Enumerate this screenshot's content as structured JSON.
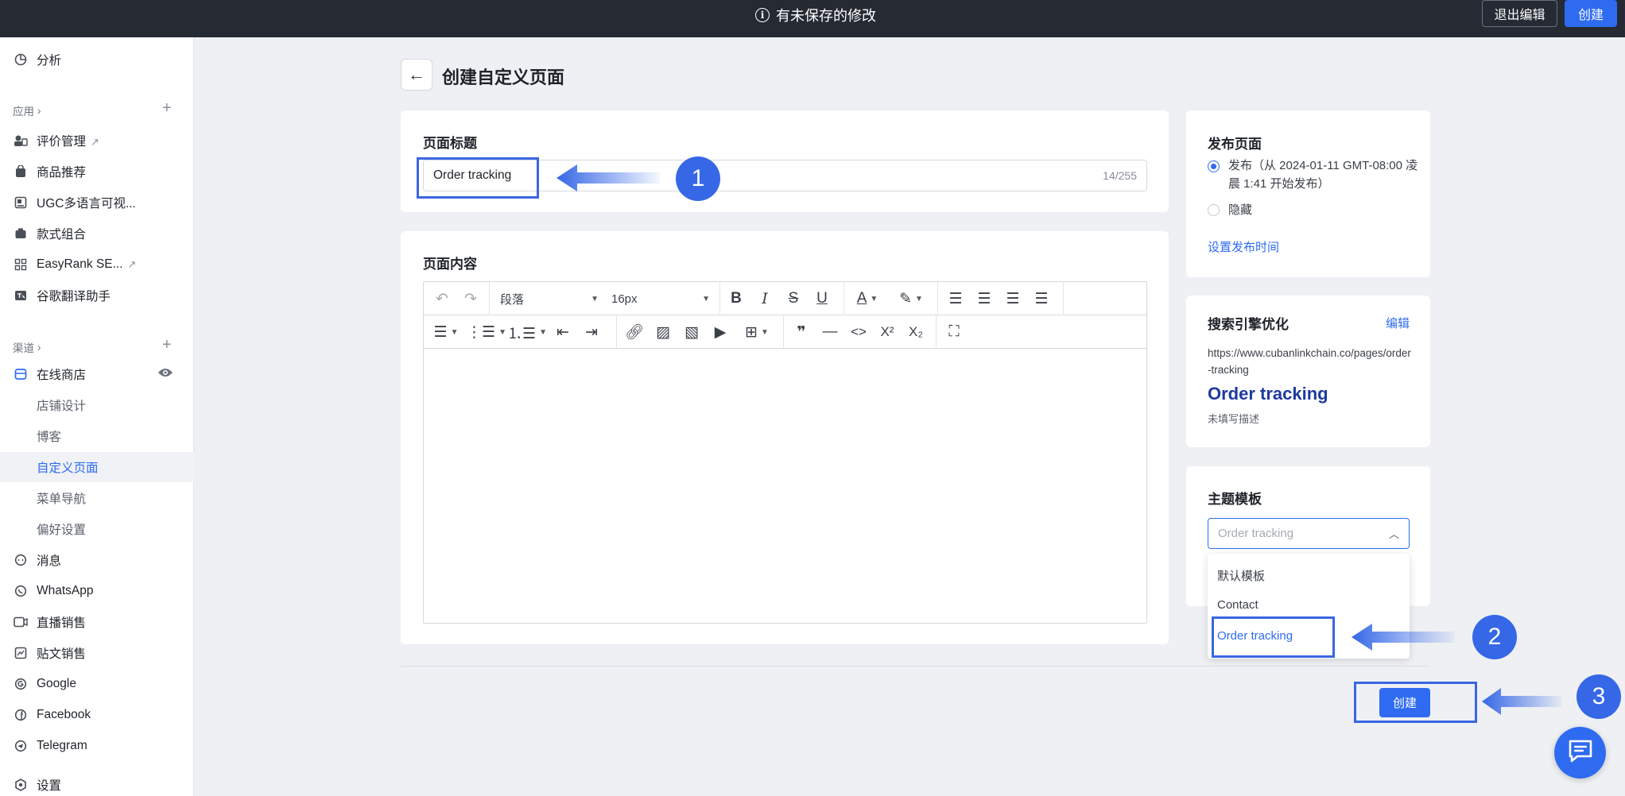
{
  "topbar": {
    "unsaved": "有未保存的修改",
    "exit_label": "退出编辑",
    "create_label": "创建"
  },
  "sidebar": {
    "analytics": "分析",
    "apps_group": "应用",
    "apps": [
      {
        "label": "评价管理",
        "icon": "review-icon",
        "external": true
      },
      {
        "label": "商品推荐",
        "icon": "bag-icon",
        "external": false
      },
      {
        "label": "UGC多语言可视...",
        "icon": "image-icon",
        "external": false
      },
      {
        "label": "款式组合",
        "icon": "box-icon",
        "external": false
      },
      {
        "label": "EasyRank SE...",
        "icon": "grid-icon",
        "external": true
      },
      {
        "label": "谷歌翻译助手",
        "icon": "translate-icon",
        "external": false
      }
    ],
    "channels_group": "渠道",
    "online_store": "在线商店",
    "store_sub": [
      "店铺设计",
      "博客",
      "自定义页面",
      "菜单导航",
      "偏好设置"
    ],
    "active_sub": "自定义页面",
    "others": [
      {
        "label": "消息",
        "icon": "message-icon"
      },
      {
        "label": "WhatsApp",
        "icon": "whatsapp-icon"
      },
      {
        "label": "直播销售",
        "icon": "live-icon"
      },
      {
        "label": "贴文销售",
        "icon": "post-icon"
      },
      {
        "label": "Google",
        "icon": "google-icon"
      },
      {
        "label": "Facebook",
        "icon": "facebook-icon"
      },
      {
        "label": "Telegram",
        "icon": "telegram-icon"
      }
    ],
    "settings": "设置"
  },
  "header": {
    "title": "创建自定义页面"
  },
  "title_card": {
    "label": "页面标题",
    "value": "Order tracking",
    "counter": "14/255"
  },
  "content_card": {
    "label": "页面内容",
    "paragraph": "段落",
    "font_size": "16px"
  },
  "publish": {
    "title": "发布页面",
    "publish_option": "发布（从 2024-01-11 GMT-08:00 凌晨 1:41 开始发布）",
    "hide_option": "隐藏",
    "set_time": "设置发布时间"
  },
  "seo": {
    "title": "搜索引擎优化",
    "edit": "编辑",
    "url": "https://www.cubanlinkchain.co/pages/order-tracking",
    "page_title": "Order tracking",
    "desc": "未填写描述"
  },
  "template": {
    "title": "主题模板",
    "placeholder": "Order tracking",
    "options": [
      "默认模板",
      "Contact",
      "Order tracking"
    ],
    "selected": "Order tracking"
  },
  "footer": {
    "create_label": "创建"
  },
  "annotations": [
    "1",
    "2",
    "3"
  ],
  "colors": {
    "accent": "#2e6bf0",
    "topbar": "#252a33",
    "annotation": "#3567e6"
  }
}
